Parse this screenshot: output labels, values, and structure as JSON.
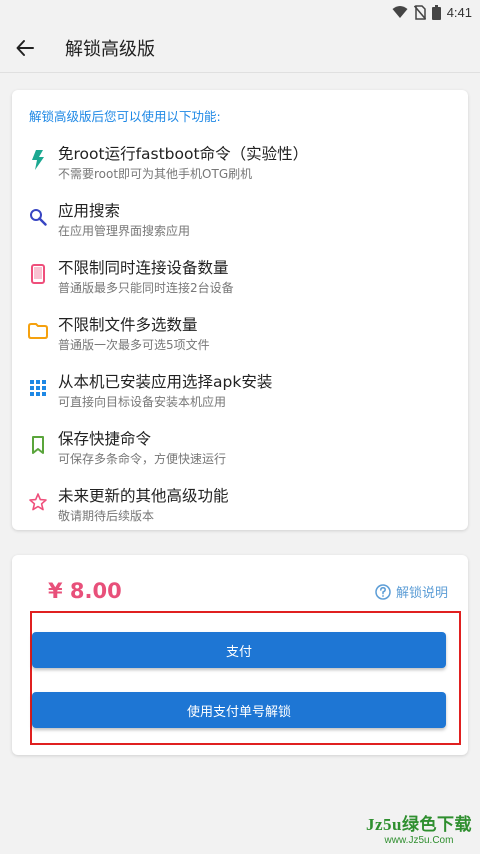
{
  "status_bar": {
    "time": "4:41",
    "icons": [
      "wifi-icon",
      "no-sim-icon",
      "battery-icon"
    ]
  },
  "app_bar": {
    "title": "解锁高级版",
    "back_icon": "arrow-back-icon"
  },
  "features": {
    "header": "解锁高级版后您可以使用以下功能:",
    "items": [
      {
        "title": "免root运行fastboot命令（实验性）",
        "desc": "不需要root即可为其他手机OTG刷机",
        "icon": "flash-icon",
        "color": "#1ba891"
      },
      {
        "title": "应用搜索",
        "desc": "在应用管理界面搜索应用",
        "icon": "search-icon",
        "color": "#3845c2"
      },
      {
        "title": "不限制同时连接设备数量",
        "desc": "普通版最多只能同时连接2台设备",
        "icon": "phone-icon",
        "color": "#ef4f7b"
      },
      {
        "title": "不限制文件多选数量",
        "desc": "普通版一次最多可选5项文件",
        "icon": "folder-icon",
        "color": "#f5a10f"
      },
      {
        "title": "从本机已安装应用选择apk安装",
        "desc": "可直接向目标设备安装本机应用",
        "icon": "apps-grid-icon",
        "color": "#1e88e5"
      },
      {
        "title": "保存快捷命令",
        "desc": "可保存多条命令，方便快速运行",
        "icon": "bookmark-icon",
        "color": "#5aa53b"
      },
      {
        "title": "未来更新的其他高级功能",
        "desc": "敬请期待后续版本",
        "icon": "star-icon",
        "color": "#ef4f7b"
      }
    ]
  },
  "payment": {
    "price": "¥ 8.00",
    "help_label": "解锁说明",
    "pay_button": "支付",
    "unlock_button": "使用支付单号解锁",
    "accent_color": "#1e76d4",
    "highlight_color": "#e02020"
  },
  "watermark": {
    "main": "Jz5u绿色下载",
    "sub": "www.Jz5u.Com"
  }
}
